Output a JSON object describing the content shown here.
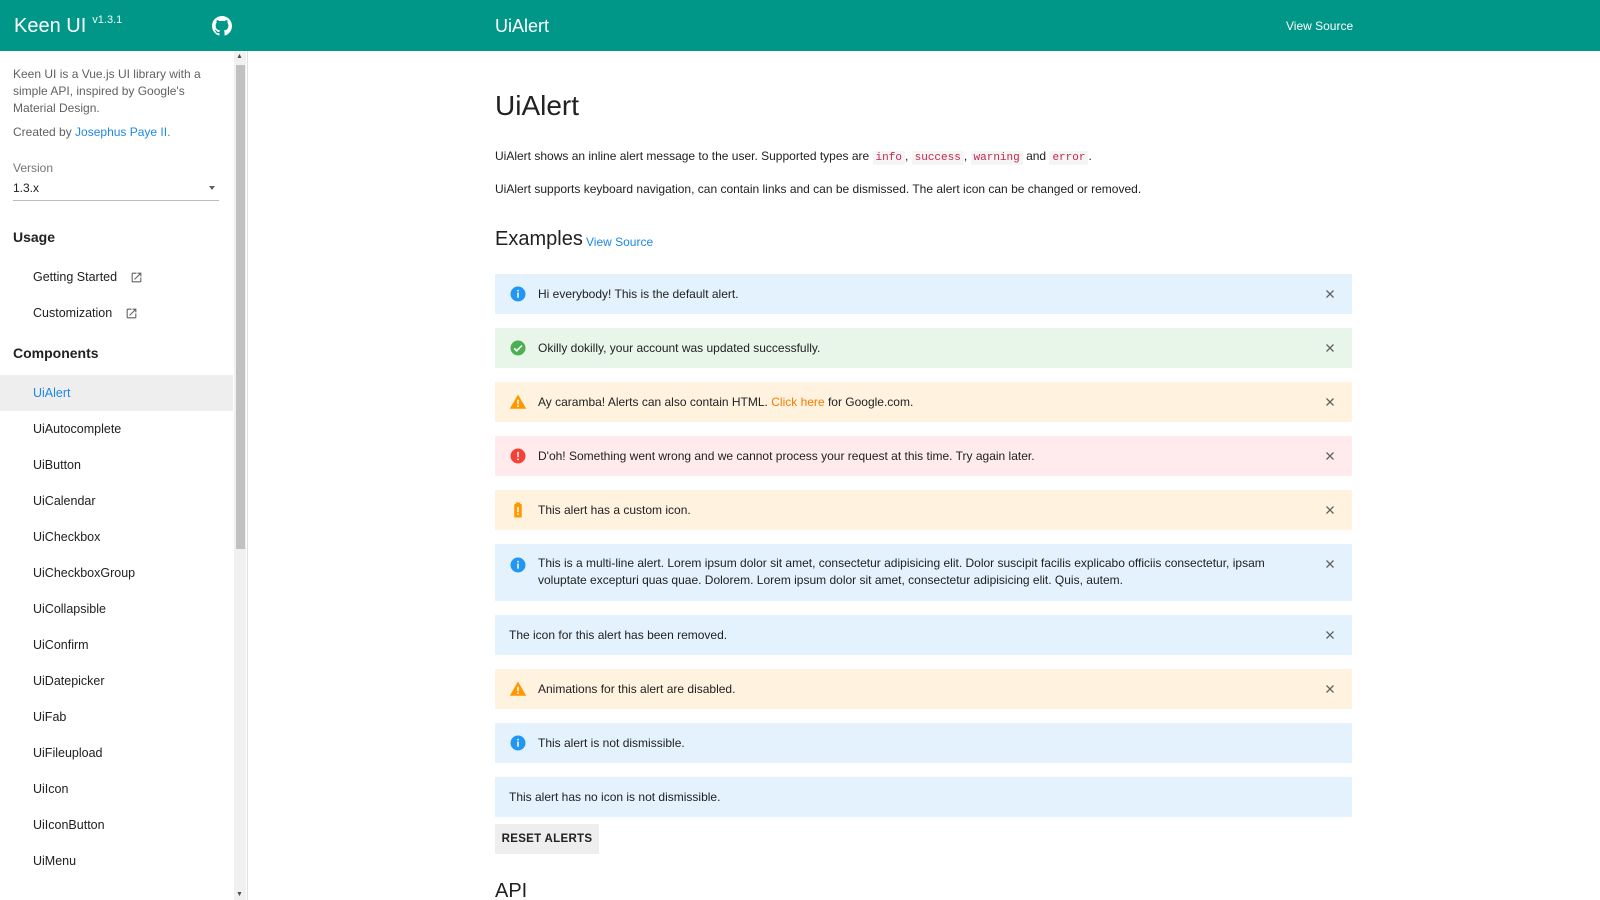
{
  "header": {
    "brand": "Keen UI",
    "version": "v1.3.1",
    "page_title": "UiAlert",
    "view_source": "View Source"
  },
  "sidebar": {
    "description": "Keen UI is a Vue.js UI library with a simple API, inspired by Google's Material Design.",
    "created_prefix": "Created by",
    "author": "Josephus Paye II.",
    "version_label": "Version",
    "version_value": "1.3.x",
    "usage_heading": "Usage",
    "usage_items": [
      {
        "label": "Getting Started"
      },
      {
        "label": "Customization"
      }
    ],
    "components_heading": "Components",
    "components": [
      {
        "label": "UiAlert",
        "active": true
      },
      {
        "label": "UiAutocomplete"
      },
      {
        "label": "UiButton"
      },
      {
        "label": "UiCalendar"
      },
      {
        "label": "UiCheckbox"
      },
      {
        "label": "UiCheckboxGroup"
      },
      {
        "label": "UiCollapsible"
      },
      {
        "label": "UiConfirm"
      },
      {
        "label": "UiDatepicker"
      },
      {
        "label": "UiFab"
      },
      {
        "label": "UiFileupload"
      },
      {
        "label": "UiIcon"
      },
      {
        "label": "UiIconButton"
      },
      {
        "label": "UiMenu"
      }
    ]
  },
  "main": {
    "title": "UiAlert",
    "intro_before": "UiAlert shows an inline alert message to the user. Supported types are",
    "types": [
      "info",
      "success",
      "warning",
      "error"
    ],
    "intro_and": "and",
    "intro_end": ".",
    "intro2": "UiAlert supports keyboard navigation, can contain links and can be dismissed. The alert icon can be changed or removed.",
    "examples_heading": "Examples",
    "examples_view_source": "View Source",
    "alerts": [
      {
        "type": "info",
        "icon": "info-icon",
        "text": "Hi everybody! This is the default alert."
      },
      {
        "type": "success",
        "icon": "check-circle-icon",
        "text": "Okilly dokilly, your account was updated successfully."
      },
      {
        "type": "warning",
        "icon": "warning-icon",
        "text_before": "Ay caramba! Alerts can also contain HTML.",
        "link": "Click here",
        "text_after": "for Google.com."
      },
      {
        "type": "error",
        "icon": "error-icon",
        "text": "D'oh! Something went wrong and we cannot process your request at this time. Try again later."
      },
      {
        "type": "warning",
        "icon": "battery-alert-icon",
        "text": "This alert has a custom icon."
      },
      {
        "type": "info",
        "icon": "info-icon",
        "text": "This is a multi-line alert. Lorem ipsum dolor sit amet, consectetur adipisicing elit. Dolor suscipit facilis explicabo officiis consectetur, ipsam voluptate excepturi quas quae. Dolorem. Lorem ipsum dolor sit amet, consectetur adipisicing elit. Quis, autem."
      },
      {
        "type": "info",
        "icon": "",
        "text": "The icon for this alert has been removed."
      },
      {
        "type": "warning",
        "icon": "warning-icon",
        "text": "Animations for this alert are disabled."
      },
      {
        "type": "info",
        "icon": "info-icon",
        "text": "This alert is not dismissible."
      },
      {
        "type": "info",
        "icon": "",
        "text": "This alert has no icon is not dismissible."
      }
    ],
    "reset_button": "RESET ALERTS",
    "api_heading": "API"
  },
  "colors": {
    "primary": "#009688",
    "info_bg": "#e3f2fd",
    "success_bg": "#e8f5e9",
    "warning_bg": "#fff3e0",
    "error_bg": "#ffebee",
    "info_icon": "#2196f3",
    "success_icon": "#4caf50",
    "warning_icon": "#ff9800",
    "error_icon": "#f44336",
    "link": "#1e88e5"
  }
}
